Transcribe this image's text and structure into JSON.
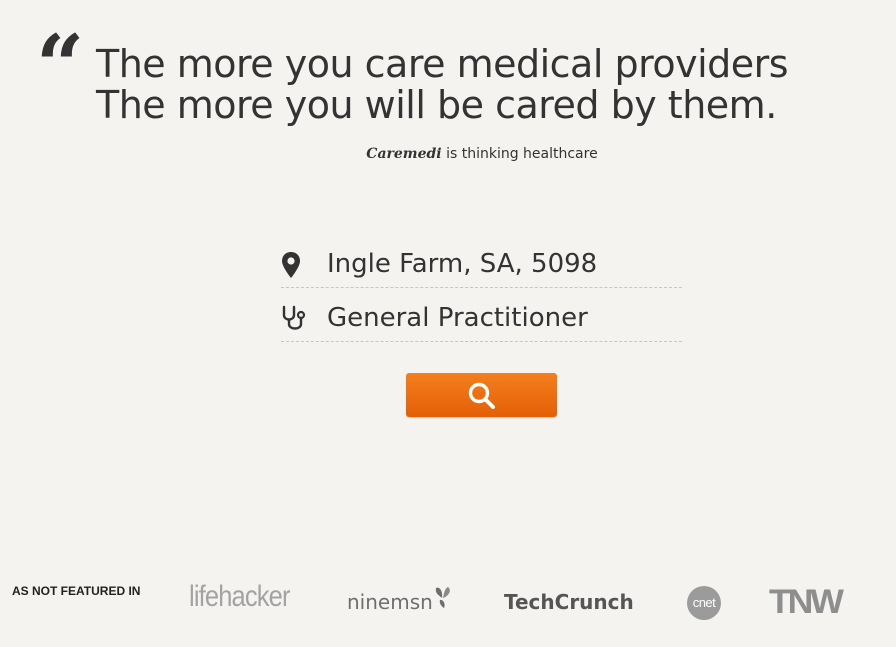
{
  "hero": {
    "quote_mark": "“",
    "line1": "The more you care medical providers",
    "line2": "The more you will be cared by them.",
    "tagline_brand": "Caremedi",
    "tagline_rest": " is thinking healthcare"
  },
  "search": {
    "location_value": "Ingle Farm, SA, 5098",
    "location_icon": "map-pin-icon",
    "specialty_value": "General Practitioner",
    "specialty_icon": "stethoscope-icon",
    "button_icon": "search-icon",
    "button_color": "#ef7314"
  },
  "featured": {
    "label": "AS NOT FEATURED IN",
    "logos": [
      "lifehacker",
      "ninemsn",
      "TechCrunch",
      "cnet",
      "TNW"
    ]
  }
}
